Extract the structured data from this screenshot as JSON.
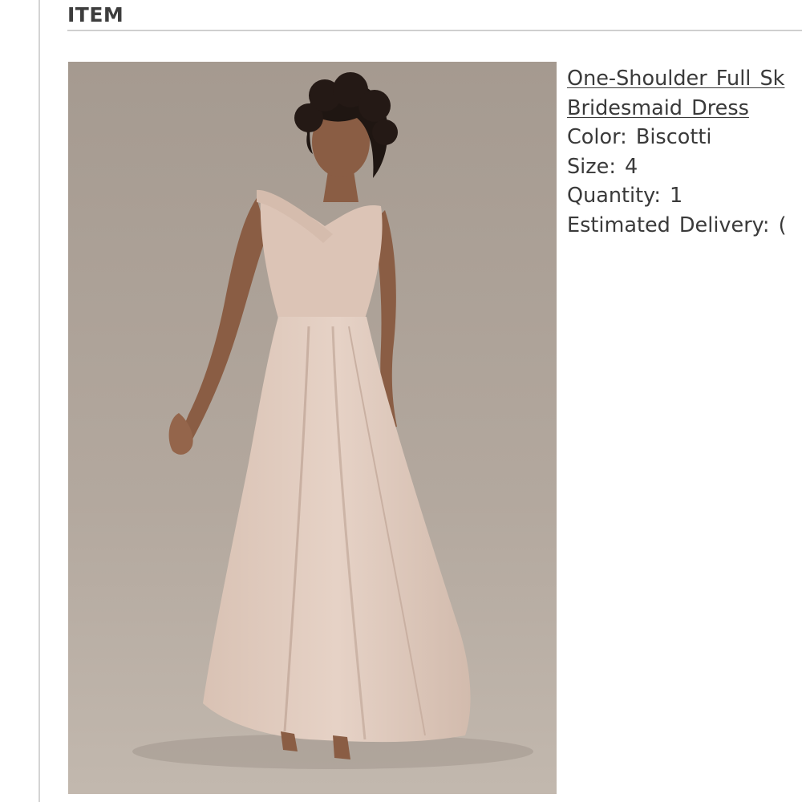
{
  "section": {
    "title": "ITEM"
  },
  "product": {
    "name_line1": "One-Shoulder Full Sk",
    "name_line2": "Bridesmaid Dress",
    "color_label": "Color:",
    "color_value": "Biscotti",
    "size_label": "Size:",
    "size_value": "4",
    "quantity_label": "Quantity:",
    "quantity_value": "1",
    "delivery_label": "Estimated Delivery:",
    "delivery_value": "("
  },
  "image": {
    "description": "Model wearing a blush one-shoulder chiffon bridesmaid gown against a taupe studio backdrop",
    "background_color": "#aea398",
    "dress_color": "#dcc6b9"
  }
}
